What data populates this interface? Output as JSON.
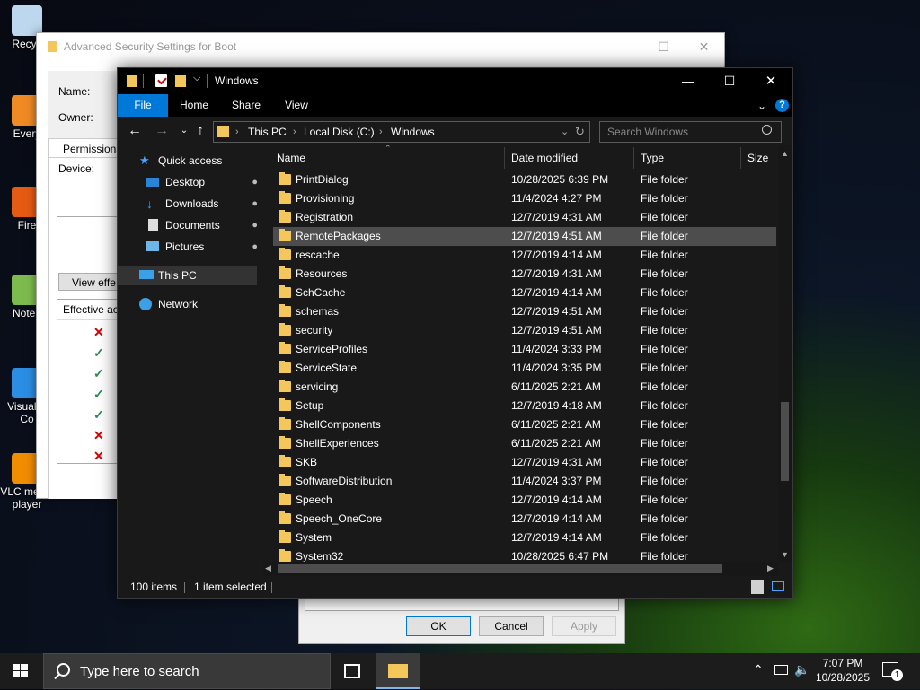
{
  "desktop": {
    "icons": [
      {
        "label": "Recyc",
        "name": "recycle-bin"
      },
      {
        "label": "Every",
        "name": "everything"
      },
      {
        "label": "Fire",
        "name": "firefox"
      },
      {
        "label": "Notep",
        "name": "notepad"
      },
      {
        "label": "Visual S\nCo",
        "name": "visual-studio-code"
      },
      {
        "label": "VLC media\nplayer",
        "name": "vlc"
      }
    ]
  },
  "adv_dialog": {
    "title": "Advanced Security Settings for Boot",
    "name_label": "Name:",
    "owner_label": "Owner:",
    "permissions_tab": "Permissions",
    "device_label": "Device:",
    "view_effective_btn": "View effe",
    "effective_access_header": "Effective ac",
    "access_marks": [
      "deny",
      "allow",
      "allow",
      "allow",
      "allow",
      "deny",
      "deny"
    ]
  },
  "perm_dialog": {
    "ok": "OK",
    "cancel": "Cancel",
    "apply": "Apply"
  },
  "explorer": {
    "title": "Windows",
    "ribbon_tabs": [
      "File",
      "Home",
      "Share",
      "View"
    ],
    "breadcrumb": [
      "This PC",
      "Local Disk (C:)",
      "Windows"
    ],
    "search_placeholder": "Search Windows",
    "nav": {
      "quick_access": "Quick access",
      "items": [
        "Desktop",
        "Downloads",
        "Documents",
        "Pictures"
      ],
      "this_pc": "This PC",
      "network": "Network"
    },
    "columns": [
      "Name",
      "Date modified",
      "Type",
      "Size"
    ],
    "rows": [
      {
        "name": "PrintDialog",
        "date": "10/28/2025 6:39 PM",
        "type": "File folder"
      },
      {
        "name": "Provisioning",
        "date": "11/4/2024 4:27 PM",
        "type": "File folder"
      },
      {
        "name": "Registration",
        "date": "12/7/2019 4:31 AM",
        "type": "File folder"
      },
      {
        "name": "RemotePackages",
        "date": "12/7/2019 4:51 AM",
        "type": "File folder",
        "selected": true
      },
      {
        "name": "rescache",
        "date": "12/7/2019 4:14 AM",
        "type": "File folder"
      },
      {
        "name": "Resources",
        "date": "12/7/2019 4:31 AM",
        "type": "File folder"
      },
      {
        "name": "SchCache",
        "date": "12/7/2019 4:14 AM",
        "type": "File folder"
      },
      {
        "name": "schemas",
        "date": "12/7/2019 4:51 AM",
        "type": "File folder"
      },
      {
        "name": "security",
        "date": "12/7/2019 4:51 AM",
        "type": "File folder"
      },
      {
        "name": "ServiceProfiles",
        "date": "11/4/2024 3:33 PM",
        "type": "File folder"
      },
      {
        "name": "ServiceState",
        "date": "11/4/2024 3:35 PM",
        "type": "File folder"
      },
      {
        "name": "servicing",
        "date": "6/11/2025 2:21 AM",
        "type": "File folder"
      },
      {
        "name": "Setup",
        "date": "12/7/2019 4:18 AM",
        "type": "File folder"
      },
      {
        "name": "ShellComponents",
        "date": "6/11/2025 2:21 AM",
        "type": "File folder"
      },
      {
        "name": "ShellExperiences",
        "date": "6/11/2025 2:21 AM",
        "type": "File folder"
      },
      {
        "name": "SKB",
        "date": "12/7/2019 4:31 AM",
        "type": "File folder"
      },
      {
        "name": "SoftwareDistribution",
        "date": "11/4/2024 3:37 PM",
        "type": "File folder"
      },
      {
        "name": "Speech",
        "date": "12/7/2019 4:14 AM",
        "type": "File folder"
      },
      {
        "name": "Speech_OneCore",
        "date": "12/7/2019 4:14 AM",
        "type": "File folder"
      },
      {
        "name": "System",
        "date": "12/7/2019 4:14 AM",
        "type": "File folder"
      },
      {
        "name": "System32",
        "date": "10/28/2025 6:47 PM",
        "type": "File folder"
      }
    ],
    "status_count": "100 items",
    "status_selected": "1 item selected",
    "accent": "#0078d7",
    "folder_color": "#f3c759"
  },
  "taskbar": {
    "search_placeholder": "Type here to search",
    "time": "7:07 PM",
    "date": "10/28/2025",
    "notification_count": "1"
  }
}
